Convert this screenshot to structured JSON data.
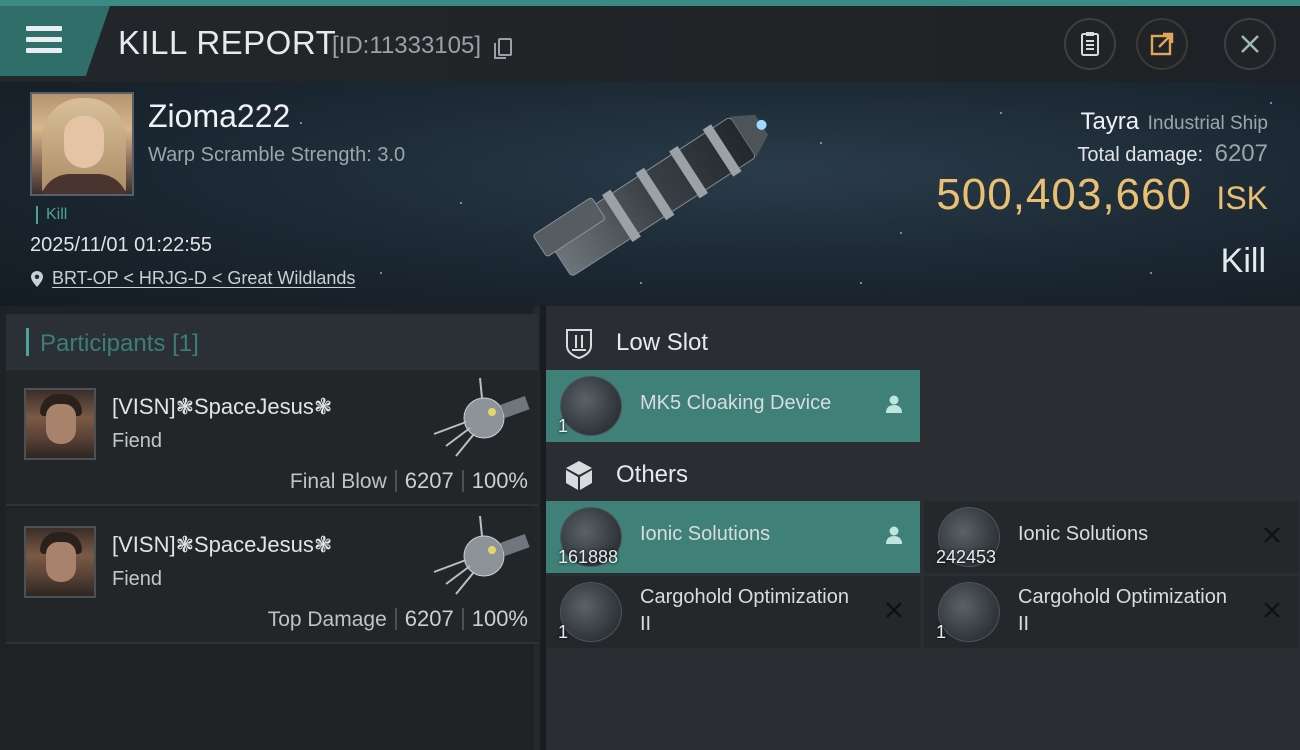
{
  "header": {
    "title": "KILL REPORT",
    "report_id": "[ID:11333105]",
    "menu_icon": "hamburger-menu-icon",
    "actions": [
      "clipboard-report-icon",
      "share-export-icon",
      "close-icon"
    ]
  },
  "victim": {
    "name": "Zioma222",
    "warp_scramble": "Warp Scramble Strength: 3.0",
    "tag": "Kill",
    "timestamp": "2025/11/01 01:22:55",
    "location": "BRT-OP < HRJG-D < Great Wildlands",
    "ship_name": "Tayra",
    "ship_class": "Industrial Ship",
    "damage_label": "Total damage:",
    "damage_value": "6207",
    "isk_value": "500,403,660",
    "isk_unit": "ISK",
    "result": "Kill"
  },
  "participants": {
    "title": "Participants",
    "count": "[1]",
    "rows": [
      {
        "name": "[VISN]❃SpaceJesus❃",
        "ship": "Fiend",
        "label": "Final Blow",
        "damage": "6207",
        "percent": "100%"
      },
      {
        "name": "[VISN]❃SpaceJesus❃",
        "ship": "Fiend",
        "label": "Top Damage",
        "damage": "6207",
        "percent": "100%"
      }
    ]
  },
  "fitting": {
    "low_slot": {
      "title": "Low Slot",
      "items": [
        {
          "name": "MK5 Cloaking Device",
          "qty": "1",
          "status": "dropped"
        }
      ]
    },
    "others": {
      "title": "Others",
      "items": [
        {
          "name": "Ionic Solutions",
          "qty": "161888",
          "status": "dropped"
        },
        {
          "name": "Ionic Solutions",
          "qty": "242453",
          "status": "destroyed"
        },
        {
          "name": "Cargohold Optimization II",
          "qty": "1",
          "status": "destroyed"
        },
        {
          "name": "Cargohold Optimization II",
          "qty": "1",
          "status": "destroyed"
        }
      ]
    }
  },
  "colors": {
    "accent": "#3f8079",
    "isk": "#e9c071",
    "dropped": "#3f8079",
    "destroyed": "#24282b"
  }
}
